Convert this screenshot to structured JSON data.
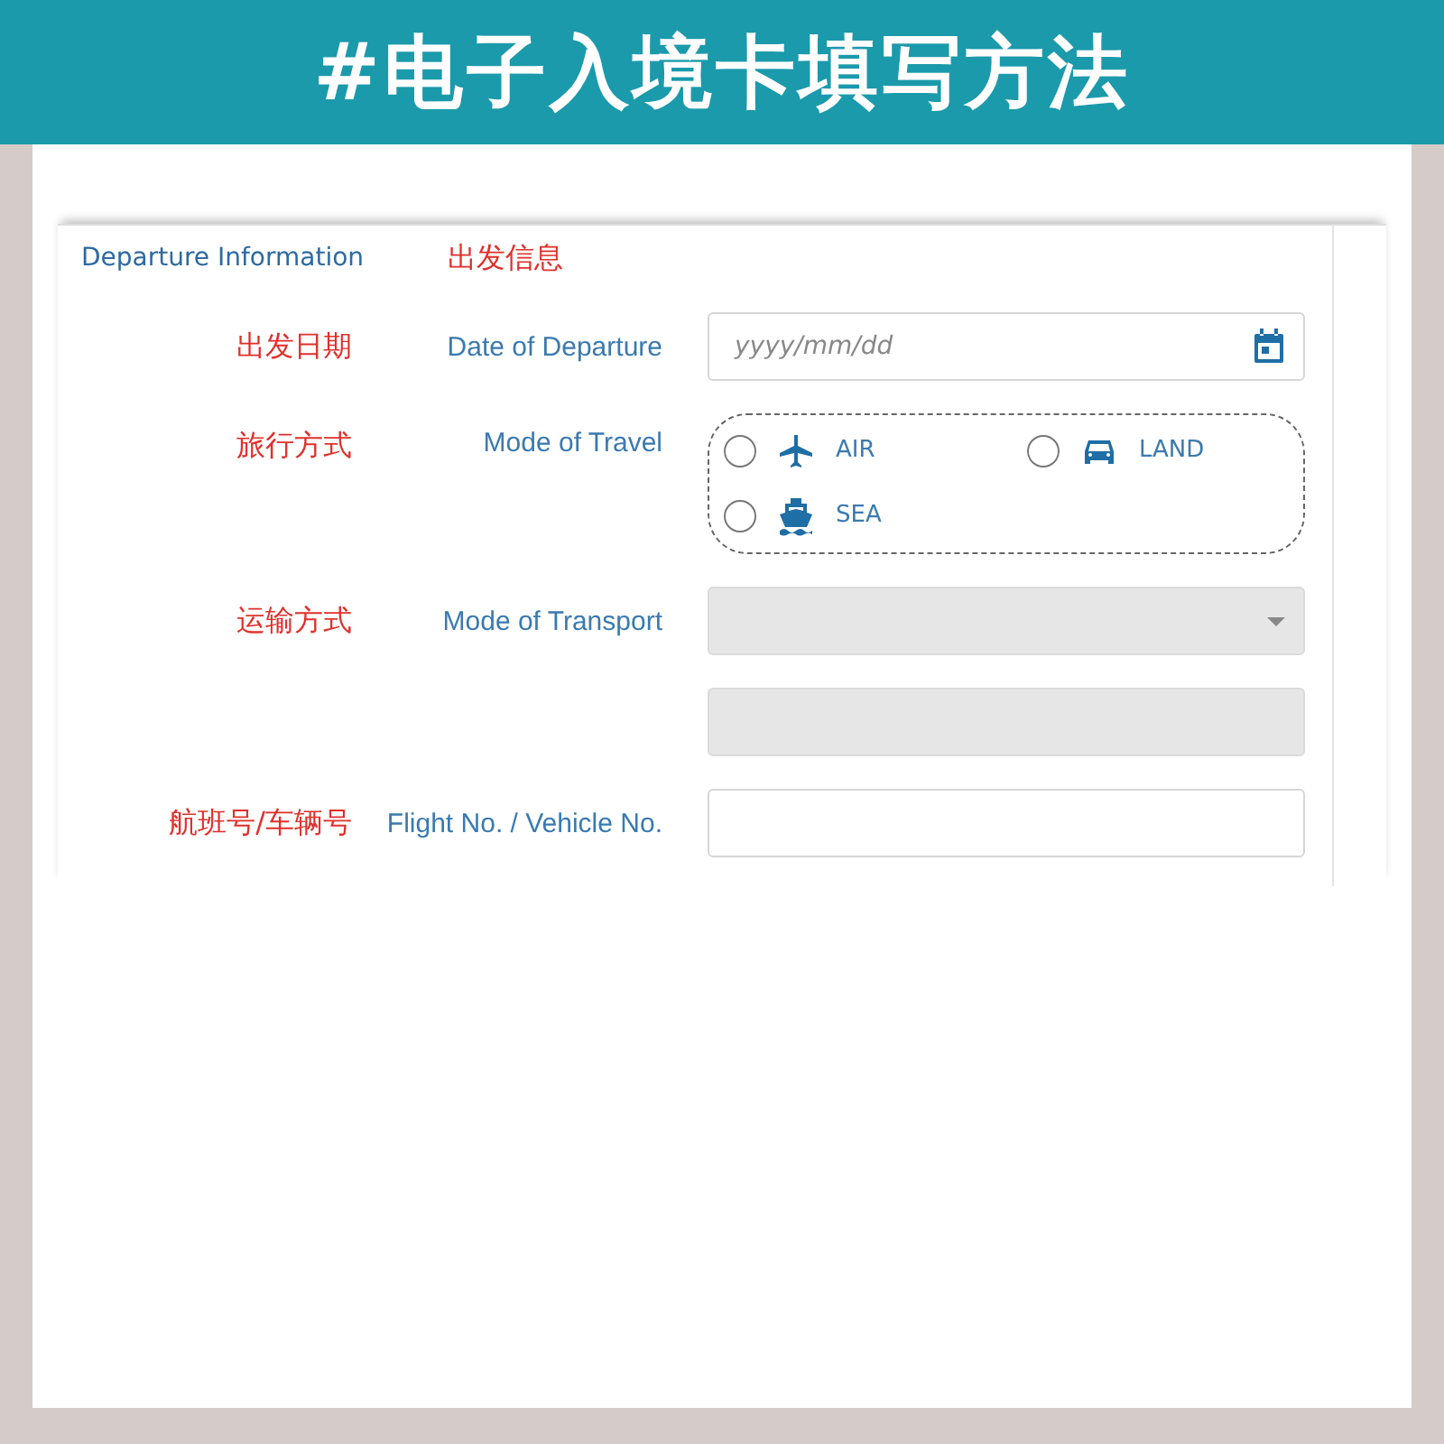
{
  "banner": {
    "title": "#电子入境卡填写方法"
  },
  "section": {
    "title": "Departure Information",
    "note": "出发信息"
  },
  "fields": [
    {
      "kind": "date",
      "note": "出发日期",
      "label": "Date of Departure",
      "placeholder": "yyyy/mm/dd",
      "disabled": false
    },
    {
      "kind": "radio",
      "note": "旅行方式",
      "label": "Mode of Travel",
      "options": [
        {
          "label": "AIR",
          "selected": false
        },
        {
          "label": "LAND",
          "selected": false
        },
        {
          "label": "SEA",
          "selected": false
        }
      ]
    },
    {
      "kind": "select",
      "note": "运输方式",
      "label": "Mode of Transport",
      "disabled": true
    },
    {
      "kind": "text",
      "disabled": true
    },
    {
      "kind": "text",
      "note": "航班号/车辆号",
      "label": "Flight No. / Vehicle No.",
      "disabled": false
    }
  ]
}
